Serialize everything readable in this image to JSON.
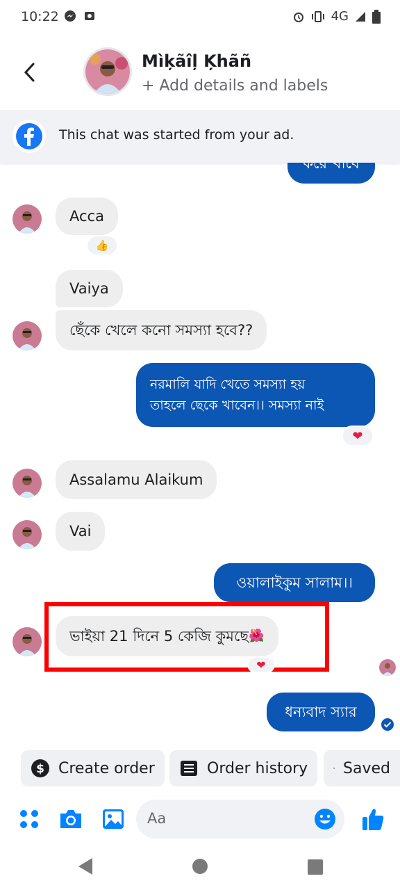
{
  "status_bar": {
    "time": "10:22",
    "network": "4G"
  },
  "header": {
    "name": "Mìķãîļ Ķhãñ",
    "subtitle": "+ Add details and labels"
  },
  "banner": {
    "text": "This chat was started from your ad."
  },
  "messages": [
    {
      "dir": "out",
      "text": "করে খাবে"
    },
    {
      "dir": "in",
      "text": "Acca",
      "reaction": "👍"
    },
    {
      "dir": "in",
      "text": "Vaiya"
    },
    {
      "dir": "in",
      "text": "ছেঁকে খেলে কনো সমস্যা হবে??"
    },
    {
      "dir": "out",
      "lines": [
        "নরমালি যাদি খেতে সমস্যা হয়",
        "তাহলে ছেকে খাবেন।। সমস্যা নাই"
      ],
      "reaction": "❤"
    },
    {
      "dir": "in",
      "text": "Assalamu Alaikum"
    },
    {
      "dir": "in",
      "text": "Vai"
    },
    {
      "dir": "out",
      "text": "ওয়ালাইকুম সালাম।।"
    },
    {
      "dir": "in",
      "text": "ভাইয়া 21 দিনে 5 কেজি কুমছে",
      "emoji": "🌺",
      "reaction": "❤"
    },
    {
      "dir": "out",
      "text": "ধন্যবাদ স্যার"
    }
  ],
  "quick_replies": [
    "Create order",
    "Order history",
    "Saved"
  ],
  "composer": {
    "placeholder": "Aa"
  },
  "colors": {
    "outgoing_bubble": "#0c56b4",
    "incoming_bubble": "#eeeeee",
    "messenger_blue": "#0084ff",
    "highlight": "#ff0000"
  },
  "icons": [
    "back-icon",
    "facebook-icon",
    "like-icon",
    "heart-icon",
    "dollar-icon",
    "list-icon",
    "chat-icon",
    "apps-icon",
    "camera-icon",
    "image-icon",
    "emoji-icon",
    "thumbs-up-icon",
    "seen-check-icon"
  ]
}
